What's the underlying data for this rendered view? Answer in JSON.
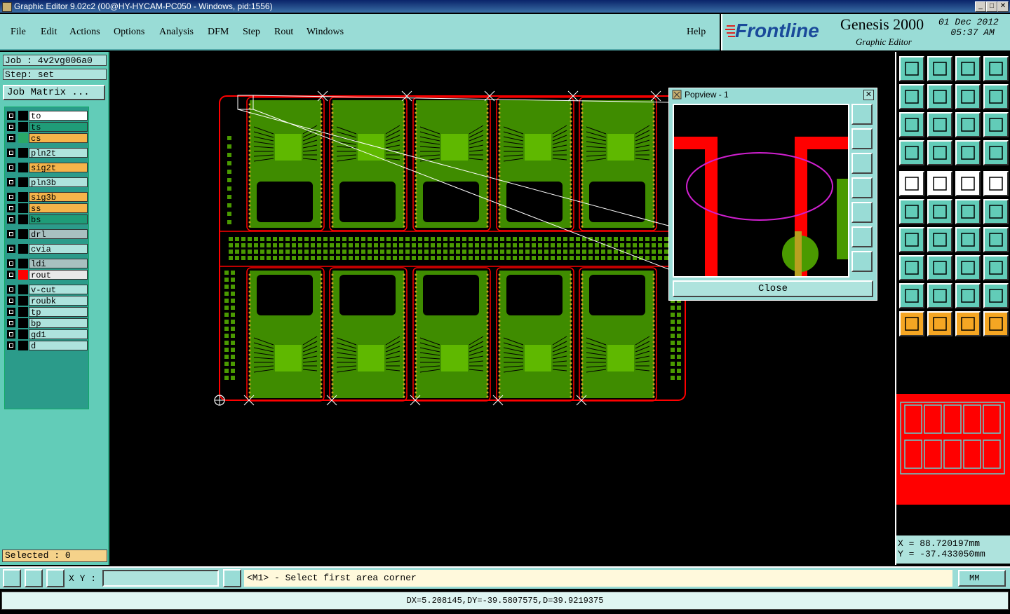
{
  "window": {
    "title": "Graphic Editor 9.02c2 (00@HY-HYCAM-PC050 - Windows, pid:1556)"
  },
  "menu": {
    "items": [
      "File",
      "Edit",
      "Actions",
      "Options",
      "Analysis",
      "DFM",
      "Step",
      "Rout",
      "Windows"
    ],
    "help": "Help"
  },
  "brand": {
    "logo": "Frontline",
    "product": "Genesis 2000",
    "subtitle": "Graphic Editor",
    "date": "01 Dec 2012",
    "time": "05:37 AM"
  },
  "job": {
    "job_label": "Job : 4v2vg006a0",
    "step_label": "Step: set",
    "matrix_button": "Job Matrix ..."
  },
  "layers": [
    {
      "name": "to",
      "color": "#ffffff",
      "swatch": ""
    },
    {
      "name": "ts",
      "color": "#1f9c78",
      "swatch": ""
    },
    {
      "name": "cs",
      "color": "#f5b44a",
      "swatch": "#2aa868"
    },
    {
      "name": "pln2t",
      "color": "#aee3dd",
      "swatch": ""
    },
    {
      "name": "sig2t",
      "color": "#f5b44a",
      "swatch": ""
    },
    {
      "name": "pln3b",
      "color": "#aee3dd",
      "swatch": ""
    },
    {
      "name": "sig3b",
      "color": "#f5b44a",
      "swatch": ""
    },
    {
      "name": "ss",
      "color": "#f5b44a",
      "swatch": ""
    },
    {
      "name": "bs",
      "color": "#1f9c78",
      "swatch": ""
    },
    {
      "name": "drl",
      "color": "#a8c0c0",
      "swatch": ""
    },
    {
      "name": "cvia",
      "color": "#aee3dd",
      "swatch": ""
    },
    {
      "name": "ldi",
      "color": "#a8c0c0",
      "swatch": ""
    },
    {
      "name": "rout",
      "color": "#e8e8e8",
      "swatch": "#ff0000"
    },
    {
      "name": "v-cut",
      "color": "#aee3dd",
      "swatch": ""
    },
    {
      "name": "roubk",
      "color": "#aee3dd",
      "swatch": ""
    },
    {
      "name": "tp",
      "color": "#aee3dd",
      "swatch": ""
    },
    {
      "name": "bp",
      "color": "#aee3dd",
      "swatch": ""
    },
    {
      "name": "gd1",
      "color": "#aee3dd",
      "swatch": ""
    },
    {
      "name": "d",
      "color": "#aee3dd",
      "swatch": ""
    }
  ],
  "selected": "Selected : 0",
  "popview": {
    "title": "Popview - 1",
    "close_label": "Close"
  },
  "coords": {
    "x": "X = 88.720197mm",
    "y": "Y = -37.433050mm"
  },
  "command": {
    "xy_label": "X Y :",
    "xy_value": "",
    "prompt": "<M1> - Select first area corner",
    "units": "MM"
  },
  "status": "DX=5.208145,DY=-39.5807575,D=39.9219375",
  "colors": {
    "panel": "#99dcd6",
    "board_green": "#4a9a00",
    "rout_red": "#ff0000"
  }
}
